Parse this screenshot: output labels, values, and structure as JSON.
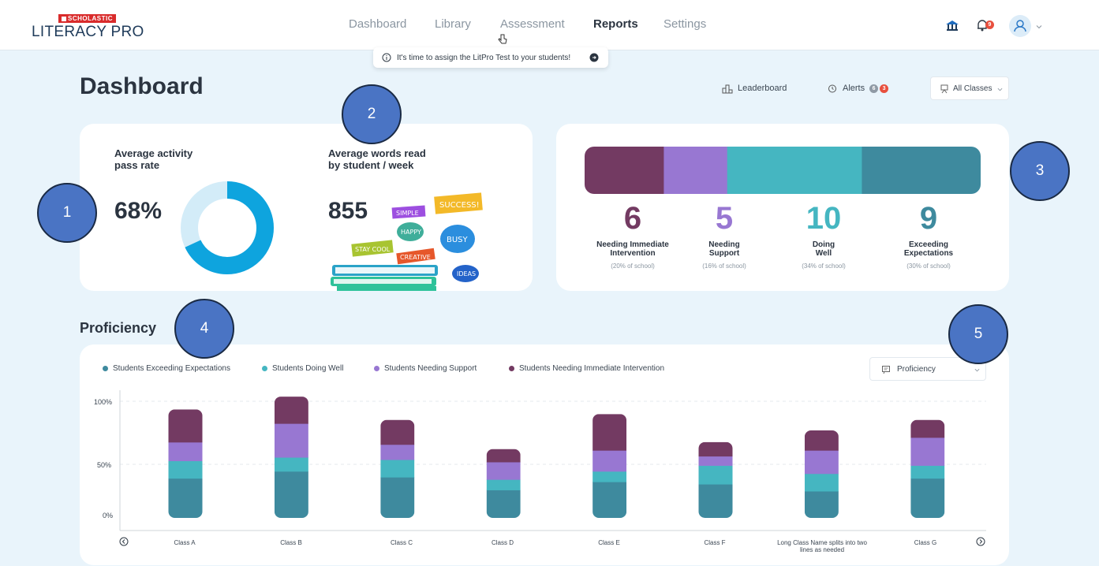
{
  "header": {
    "brand": "SCHOLASTIC",
    "app_name": "LITERACY PRO",
    "nav": [
      {
        "label": "Dashboard",
        "active": false
      },
      {
        "label": "Library",
        "active": false
      },
      {
        "label": "Assessment",
        "active": false
      },
      {
        "label": "Reports",
        "active": true
      },
      {
        "label": "Settings",
        "active": false
      }
    ],
    "icons": [
      "school-icon",
      "bell-icon",
      "user-icon",
      "chevron-down-icon"
    ],
    "notification_count": "9"
  },
  "toast": {
    "message": "It's time to assign the LitPro Test to your students!",
    "icons": [
      "info-icon",
      "arrow-right-circle-icon"
    ]
  },
  "page": {
    "title": "Dashboard",
    "leaderboard_label": "Leaderboard",
    "alerts_label": "Alerts",
    "alerts_count_gray": "6",
    "alerts_count_red": "3",
    "class_select": "All Classes"
  },
  "stats": {
    "pass_rate_label_1": "Average activity",
    "pass_rate_label_2": "pass rate",
    "pass_rate_value": "68%",
    "pass_rate_fraction": 0.68,
    "words_label_1": "Average words read",
    "words_label_2": "by student / week",
    "words_value": "855",
    "words_art_tags": [
      "SIMPLE",
      "SUCCESS!",
      "HAPPY",
      "BUSY",
      "STAY COOL",
      "CREATIVE",
      "IDEAS"
    ]
  },
  "segments": [
    {
      "value": "6",
      "label_1": "Needing Immediate",
      "label_2": "Intervention",
      "sub": "(20% of school)",
      "color": "#733a62",
      "fraction": 0.2
    },
    {
      "value": "5",
      "label_1": "Needing",
      "label_2": "Support",
      "sub": "(16% of school)",
      "color": "#9877d2",
      "fraction": 0.16
    },
    {
      "value": "10",
      "label_1": "Doing",
      "label_2": "Well",
      "sub": "(34% of school)",
      "color": "#45b6c1",
      "fraction": 0.34
    },
    {
      "value": "9",
      "label_1": "Exceeding",
      "label_2": "Expectations",
      "sub": "(30% of school)",
      "color": "#3e8a9e",
      "fraction": 0.3
    }
  ],
  "proficiency": {
    "title": "Proficiency",
    "select_label": "Proficiency"
  },
  "chart_data": {
    "type": "bar",
    "stacked": true,
    "categories": [
      "Class A",
      "Class B",
      "Class C",
      "Class D",
      "Class E",
      "Class F",
      "Long Class Name splits into two lines as needed",
      "Class G"
    ],
    "series": [
      {
        "name": "Students Exceeding Expectations",
        "color": "#3e8a9e",
        "values": [
          34,
          40,
          35,
          24,
          31,
          29,
          23,
          34
        ]
      },
      {
        "name": "Students Doing Well",
        "color": "#45b6c1",
        "values": [
          15,
          12,
          15,
          9,
          9,
          16,
          15,
          11
        ]
      },
      {
        "name": "Students Needing Support",
        "color": "#9877d2",
        "values": [
          16,
          29,
          13,
          15,
          18,
          8,
          20,
          24
        ]
      },
      {
        "name": "Students Needing Immediate Intervention",
        "color": "#733a62",
        "values": [
          28,
          23,
          21,
          11,
          31,
          12,
          17,
          15
        ]
      }
    ],
    "yticks": [
      "100%",
      "50%",
      "0%"
    ],
    "ylim": [
      0,
      100
    ],
    "legend": "top-left",
    "grid": true
  },
  "callouts": [
    "1",
    "2",
    "3",
    "4",
    "5"
  ]
}
